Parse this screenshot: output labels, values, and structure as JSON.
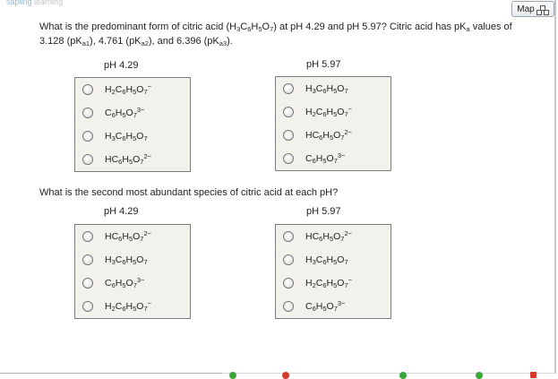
{
  "header": {
    "logo_part1": "sapling",
    "logo_part2": "learning",
    "map_label": "Map"
  },
  "q1": {
    "parts": [
      {
        "t": "What is the predominant form of citric acid (H"
      },
      {
        "sub": "3"
      },
      {
        "t": "C"
      },
      {
        "sub": "6"
      },
      {
        "t": "H"
      },
      {
        "sub": "5"
      },
      {
        "t": "O"
      },
      {
        "sub": "7"
      },
      {
        "t": ") at pH 4.29 and pH 5.97? Citric acid has pK"
      },
      {
        "sub": "a"
      },
      {
        "t": " values of 3.128 (pK"
      },
      {
        "sub": "a1"
      },
      {
        "t": "), 4.761 (pK"
      },
      {
        "sub": "a2"
      },
      {
        "t": "), and 6.396 (pK"
      },
      {
        "sub": "a3"
      },
      {
        "t": ")."
      }
    ],
    "col1_header": "pH 4.29",
    "col2_header": "pH 5.97",
    "col1_options": [
      [
        {
          "t": "H"
        },
        {
          "sub": "2"
        },
        {
          "t": "C"
        },
        {
          "sub": "6"
        },
        {
          "t": "H"
        },
        {
          "sub": "5"
        },
        {
          "t": "O"
        },
        {
          "sub": "7"
        },
        {
          "sup": "−"
        }
      ],
      [
        {
          "t": "C"
        },
        {
          "sub": "6"
        },
        {
          "t": "H"
        },
        {
          "sub": "5"
        },
        {
          "t": "O"
        },
        {
          "sub": "7"
        },
        {
          "sup": "3−"
        }
      ],
      [
        {
          "t": "H"
        },
        {
          "sub": "3"
        },
        {
          "t": "C"
        },
        {
          "sub": "6"
        },
        {
          "t": "H"
        },
        {
          "sub": "5"
        },
        {
          "t": "O"
        },
        {
          "sub": "7"
        }
      ],
      [
        {
          "t": "HC"
        },
        {
          "sub": "6"
        },
        {
          "t": "H"
        },
        {
          "sub": "5"
        },
        {
          "t": "O"
        },
        {
          "sub": "7"
        },
        {
          "sup": "2−"
        }
      ]
    ],
    "col2_options": [
      [
        {
          "t": "H"
        },
        {
          "sub": "3"
        },
        {
          "t": "C"
        },
        {
          "sub": "6"
        },
        {
          "t": "H"
        },
        {
          "sub": "5"
        },
        {
          "t": "O"
        },
        {
          "sub": "7"
        }
      ],
      [
        {
          "t": "H"
        },
        {
          "sub": "2"
        },
        {
          "t": "C"
        },
        {
          "sub": "6"
        },
        {
          "t": "H"
        },
        {
          "sub": "5"
        },
        {
          "t": "O"
        },
        {
          "sub": "7"
        },
        {
          "sup": "−"
        }
      ],
      [
        {
          "t": "HC"
        },
        {
          "sub": "6"
        },
        {
          "t": "H"
        },
        {
          "sub": "5"
        },
        {
          "t": "O"
        },
        {
          "sub": "7"
        },
        {
          "sup": "2−"
        }
      ],
      [
        {
          "t": "C"
        },
        {
          "sub": "6"
        },
        {
          "t": "H"
        },
        {
          "sub": "5"
        },
        {
          "t": "O"
        },
        {
          "sub": "7"
        },
        {
          "sup": "3−"
        }
      ]
    ]
  },
  "q2": {
    "parts": [
      {
        "t": "What is the second most abundant species of citric acid at each pH?"
      }
    ],
    "col1_header": "pH 4.29",
    "col2_header": "pH 5.97",
    "col1_options": [
      [
        {
          "t": "HC"
        },
        {
          "sub": "6"
        },
        {
          "t": "H"
        },
        {
          "sub": "5"
        },
        {
          "t": "O"
        },
        {
          "sub": "7"
        },
        {
          "sup": "2−"
        }
      ],
      [
        {
          "t": "H"
        },
        {
          "sub": "3"
        },
        {
          "t": "C"
        },
        {
          "sub": "6"
        },
        {
          "t": "H"
        },
        {
          "sub": "5"
        },
        {
          "t": "O"
        },
        {
          "sub": "7"
        }
      ],
      [
        {
          "t": "C"
        },
        {
          "sub": "6"
        },
        {
          "t": "H"
        },
        {
          "sub": "5"
        },
        {
          "t": "O"
        },
        {
          "sub": "7"
        },
        {
          "sup": "3−"
        }
      ],
      [
        {
          "t": "H"
        },
        {
          "sub": "2"
        },
        {
          "t": "C"
        },
        {
          "sub": "6"
        },
        {
          "t": "H"
        },
        {
          "sub": "5"
        },
        {
          "t": "O"
        },
        {
          "sub": "7"
        },
        {
          "sup": "−"
        }
      ]
    ],
    "col2_options": [
      [
        {
          "t": "HC"
        },
        {
          "sub": "6"
        },
        {
          "t": "H"
        },
        {
          "sub": "5"
        },
        {
          "t": "O"
        },
        {
          "sub": "7"
        },
        {
          "sup": "2−"
        }
      ],
      [
        {
          "t": "H"
        },
        {
          "sub": "3"
        },
        {
          "t": "C"
        },
        {
          "sub": "6"
        },
        {
          "t": "H"
        },
        {
          "sub": "5"
        },
        {
          "t": "O"
        },
        {
          "sub": "7"
        }
      ],
      [
        {
          "t": "H"
        },
        {
          "sub": "2"
        },
        {
          "t": "C"
        },
        {
          "sub": "6"
        },
        {
          "t": "H"
        },
        {
          "sub": "5"
        },
        {
          "t": "O"
        },
        {
          "sub": "7"
        },
        {
          "sup": "−"
        }
      ],
      [
        {
          "t": "C"
        },
        {
          "sub": "6"
        },
        {
          "t": "H"
        },
        {
          "sub": "5"
        },
        {
          "t": "O"
        },
        {
          "sub": "7"
        },
        {
          "sup": "3−"
        }
      ]
    ]
  },
  "colors": {
    "accent_green": "#3aa63a",
    "accent_red": "#d33a2c",
    "box_bg": "#f3f1ec"
  }
}
